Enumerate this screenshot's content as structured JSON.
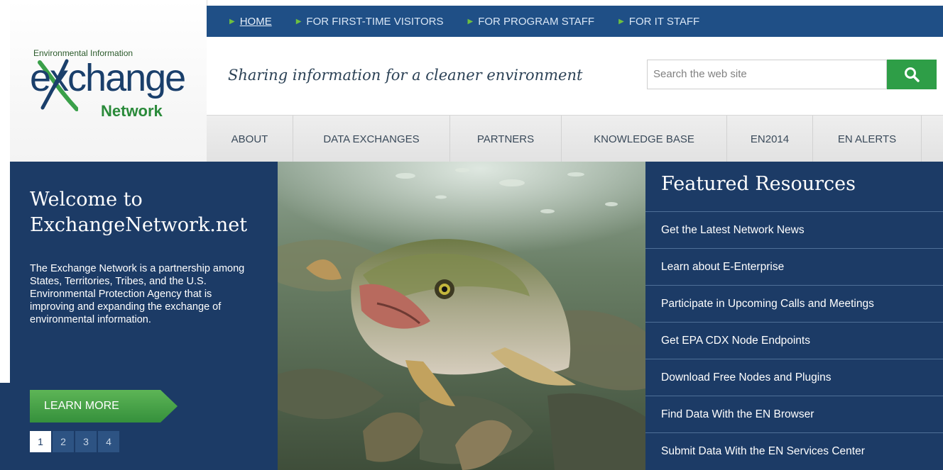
{
  "logo": {
    "caption": "Environmental Information",
    "word": "exchange",
    "sub": "Network"
  },
  "topnav": [
    {
      "label": "HOME"
    },
    {
      "label": "FOR FIRST-TIME VISITORS"
    },
    {
      "label": "FOR PROGRAM STAFF"
    },
    {
      "label": "FOR IT STAFF"
    }
  ],
  "tagline": "Sharing information for a cleaner environment",
  "search": {
    "placeholder": "Search the web site",
    "icon": "search-icon"
  },
  "mainnav": [
    {
      "label": "ABOUT"
    },
    {
      "label": "DATA EXCHANGES"
    },
    {
      "label": "PARTNERS"
    },
    {
      "label": "KNOWLEDGE BASE"
    },
    {
      "label": "EN2014"
    },
    {
      "label": "EN ALERTS"
    }
  ],
  "welcome": {
    "title": "Welcome to ExchangeNetwork.net",
    "body": "The Exchange Network is a partnership among States, Territories, Tribes, and the U.S. Environmental Protection Agency that is improving and expanding the exchange of environmental information.",
    "button": "LEARN MORE",
    "pages": [
      "1",
      "2",
      "3",
      "4"
    ],
    "current_page": "1"
  },
  "featured": {
    "title": "Featured Resources",
    "items": [
      "Get the Latest Network News",
      "Learn about E-Enterprise",
      "Participate in Upcoming Calls and Meetings",
      "Get EPA CDX Node Endpoints",
      "Download Free Nodes and Plugins",
      "Find Data With the EN Browser",
      "Submit Data With the EN Services Center"
    ]
  },
  "colors": {
    "navy": "#1c3b66",
    "topbar": "#1f4f86",
    "green": "#2e9e47",
    "accent_arrow": "#6ec040"
  }
}
